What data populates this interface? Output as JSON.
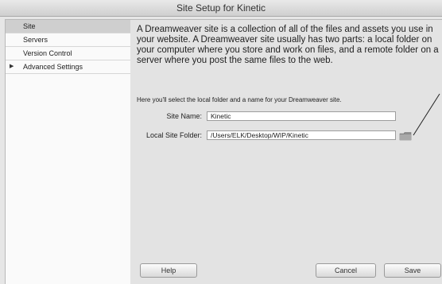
{
  "window": {
    "title": "Site Setup for Kinetic"
  },
  "sidebar": {
    "items": [
      {
        "label": "Site",
        "selected": true
      },
      {
        "label": "Servers",
        "selected": false
      },
      {
        "label": "Version Control",
        "selected": false
      },
      {
        "label": "Advanced Settings",
        "selected": false,
        "expandable": true
      }
    ]
  },
  "main": {
    "intro": "A Dreamweaver site is a collection of all of the files and assets you use in your website. A Dreamweaver site usually has two parts: a local folder on your computer where you store and work on files, and a remote folder on a server where you post the same files to the web.",
    "hint": "Here you'll select the local folder and a name for your Dreamweaver site.",
    "site_name": {
      "label": "Site Name:",
      "value": "Kinetic"
    },
    "local_folder": {
      "label": "Local Site Folder:",
      "value": "/Users/ELK/Desktop/WIP/Kinetic"
    },
    "browse_icon": "folder-icon"
  },
  "footer": {
    "help_label": "Help",
    "cancel_label": "Cancel",
    "save_label": "Save"
  }
}
